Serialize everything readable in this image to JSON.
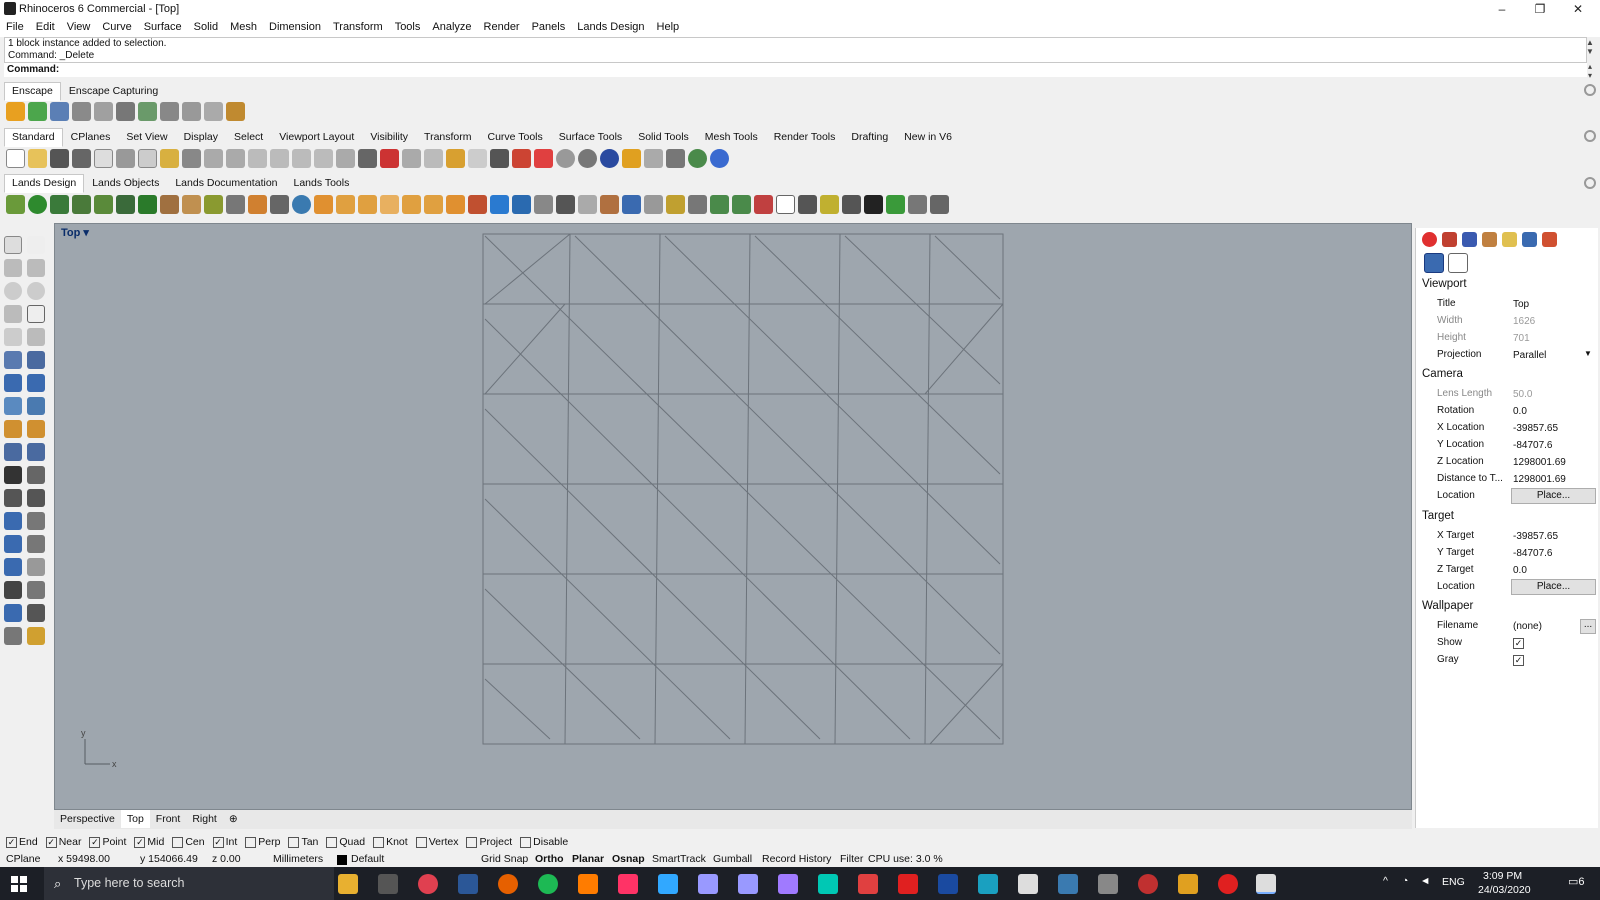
{
  "window": {
    "title": "Rhinoceros 6 Commercial - [Top]",
    "minimize": "–",
    "maximize": "❐",
    "close": "✕"
  },
  "menu": [
    "File",
    "Edit",
    "View",
    "Curve",
    "Surface",
    "Solid",
    "Mesh",
    "Dimension",
    "Transform",
    "Tools",
    "Analyze",
    "Render",
    "Panels",
    "Lands Design",
    "Help"
  ],
  "command_history": [
    "1 block instance added to selection.",
    "Command: _Delete"
  ],
  "command_prompt": "Command:",
  "enscape_tabs": [
    "Enscape",
    "Enscape Capturing"
  ],
  "standard_tabs": [
    "Standard",
    "CPlanes",
    "Set View",
    "Display",
    "Select",
    "Viewport Layout",
    "Visibility",
    "Transform",
    "Curve Tools",
    "Surface Tools",
    "Solid Tools",
    "Mesh Tools",
    "Render Tools",
    "Drafting",
    "New in V6"
  ],
  "lands_tabs": [
    "Lands Design",
    "Lands Objects",
    "Lands Documentation",
    "Lands Tools"
  ],
  "viewport": {
    "label": "Top",
    "axis_y": "y",
    "axis_x": "x"
  },
  "viewport_tabs": [
    "Perspective",
    "Top",
    "Front",
    "Right"
  ],
  "panel": {
    "viewport_section": "Viewport",
    "title_label": "Title",
    "title_value": "Top",
    "width_label": "Width",
    "width_value": "1626",
    "height_label": "Height",
    "height_value": "701",
    "projection_label": "Projection",
    "projection_value": "Parallel",
    "camera_section": "Camera",
    "lens_label": "Lens Length",
    "lens_value": "50.0",
    "rotation_label": "Rotation",
    "rotation_value": "0.0",
    "xloc_label": "X Location",
    "xloc_value": "-39857.65",
    "yloc_label": "Y Location",
    "yloc_value": "-84707.6",
    "zloc_label": "Z Location",
    "zloc_value": "1298001.69",
    "dist_label": "Distance to T...",
    "dist_value": "1298001.69",
    "camloc_label": "Location",
    "camloc_button": "Place...",
    "target_section": "Target",
    "xt_label": "X Target",
    "xt_value": "-39857.65",
    "yt_label": "Y Target",
    "yt_value": "-84707.6",
    "zt_label": "Z Target",
    "zt_value": "0.0",
    "tloc_label": "Location",
    "tloc_button": "Place...",
    "wallpaper_section": "Wallpaper",
    "filename_label": "Filename",
    "filename_value": "(none)",
    "filename_button": "...",
    "show_label": "Show",
    "gray_label": "Gray"
  },
  "osnaps": [
    {
      "label": "End",
      "checked": true
    },
    {
      "label": "Near",
      "checked": true
    },
    {
      "label": "Point",
      "checked": true
    },
    {
      "label": "Mid",
      "checked": true
    },
    {
      "label": "Cen",
      "checked": false
    },
    {
      "label": "Int",
      "checked": true
    },
    {
      "label": "Perp",
      "checked": false
    },
    {
      "label": "Tan",
      "checked": false
    },
    {
      "label": "Quad",
      "checked": false
    },
    {
      "label": "Knot",
      "checked": false
    },
    {
      "label": "Vertex",
      "checked": false
    },
    {
      "label": "Project",
      "checked": false
    },
    {
      "label": "Disable",
      "checked": false
    }
  ],
  "status": {
    "cplane": "CPlane",
    "x": "x 59498.00",
    "y": "y 154066.49",
    "z": "z 0.00",
    "units": "Millimeters",
    "layer": "Default",
    "grid_snap": "Grid Snap",
    "ortho": "Ortho",
    "planar": "Planar",
    "osnap": "Osnap",
    "smarttrack": "SmartTrack",
    "gumball": "Gumball",
    "record_history": "Record History",
    "filter": "Filter",
    "cpu": "CPU use: 3.0 %"
  },
  "taskbar": {
    "search_placeholder": "Type here to search",
    "lang": "ENG",
    "time": "3:09 PM",
    "date": "24/03/2020",
    "notif": "6"
  }
}
